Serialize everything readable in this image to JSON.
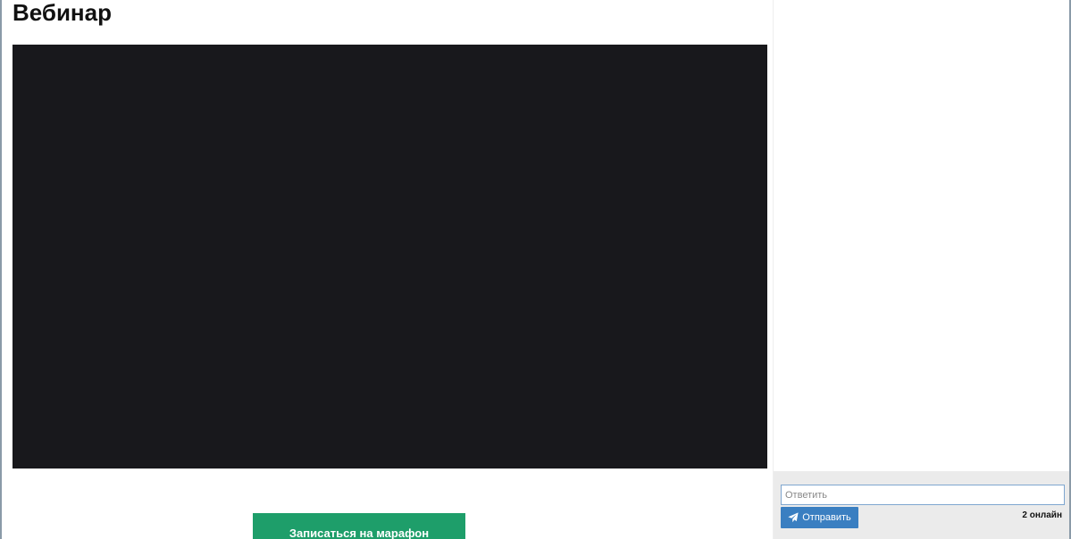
{
  "page": {
    "title": "Вебинар"
  },
  "main": {
    "cta_label": "Записаться на марафон"
  },
  "chat": {
    "reply_placeholder": "Ответить",
    "reply_value": "",
    "send_label": "Отправить",
    "send_icon": "paper-plane-icon",
    "online_text": "2 онлайн"
  },
  "colors": {
    "video_background": "#18181c",
    "cta_button": "#1e9e6a",
    "send_button": "#3a7fc1",
    "chat_footer": "#ebebeb"
  }
}
